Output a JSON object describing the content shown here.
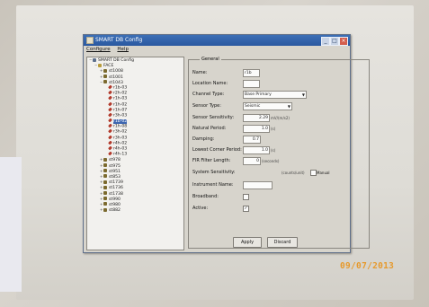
{
  "window": {
    "title": "SMART DB Config",
    "menu": [
      "Configure",
      "Help"
    ],
    "min_icon": "minimize-icon",
    "max_icon": "maximize-icon",
    "close_icon": "close-icon"
  },
  "tree": {
    "items": [
      {
        "label": "SMART DB Config",
        "depth": 0,
        "toggle": "−",
        "icon": "root-icon",
        "kind": "root"
      },
      {
        "label": "FACE",
        "depth": 1,
        "toggle": "−",
        "icon": "folder-icon",
        "kind": "folder"
      },
      {
        "label": "st1008",
        "depth": 2,
        "toggle": "+",
        "icon": "station-icon",
        "kind": "station"
      },
      {
        "label": "st1001",
        "depth": 2,
        "toggle": "+",
        "icon": "station-icon",
        "kind": "station"
      },
      {
        "label": "st1043",
        "depth": 2,
        "toggle": "−",
        "icon": "station-icon",
        "kind": "station"
      },
      {
        "label": "r1b-03",
        "depth": 3,
        "toggle": "",
        "icon": "sensor-icon",
        "kind": "sensor"
      },
      {
        "label": "r2h-02",
        "depth": 3,
        "toggle": "",
        "icon": "sensor-icon",
        "kind": "sensor"
      },
      {
        "label": "r1h-03",
        "depth": 3,
        "toggle": "",
        "icon": "sensor-icon",
        "kind": "sensor"
      },
      {
        "label": "r1h-02",
        "depth": 3,
        "toggle": "",
        "icon": "sensor-icon",
        "kind": "sensor"
      },
      {
        "label": "r1h-07",
        "depth": 3,
        "toggle": "",
        "icon": "sensor-icon",
        "kind": "sensor"
      },
      {
        "label": "r3h-03",
        "depth": 3,
        "toggle": "",
        "icon": "sensor-icon",
        "kind": "sensor"
      },
      {
        "label": "r1b-02",
        "depth": 3,
        "toggle": "",
        "icon": "sensor-icon",
        "kind": "sensor",
        "selected": true
      },
      {
        "label": "r1h-08",
        "depth": 3,
        "toggle": "",
        "icon": "sensor-icon",
        "kind": "sensor"
      },
      {
        "label": "r3h-02",
        "depth": 3,
        "toggle": "",
        "icon": "sensor-icon",
        "kind": "sensor"
      },
      {
        "label": "r3h-03",
        "depth": 3,
        "toggle": "",
        "icon": "sensor-icon",
        "kind": "sensor"
      },
      {
        "label": "r4h-02",
        "depth": 3,
        "toggle": "",
        "icon": "sensor-icon",
        "kind": "sensor"
      },
      {
        "label": "r4h-03",
        "depth": 3,
        "toggle": "",
        "icon": "sensor-icon",
        "kind": "sensor"
      },
      {
        "label": "r4h-13",
        "depth": 3,
        "toggle": "",
        "icon": "sensor-icon",
        "kind": "sensor"
      },
      {
        "label": "st978",
        "depth": 2,
        "toggle": "+",
        "icon": "station-icon",
        "kind": "station"
      },
      {
        "label": "st975",
        "depth": 2,
        "toggle": "+",
        "icon": "station-icon",
        "kind": "station"
      },
      {
        "label": "st951",
        "depth": 2,
        "toggle": "+",
        "icon": "station-icon",
        "kind": "station"
      },
      {
        "label": "st853",
        "depth": 2,
        "toggle": "+",
        "icon": "station-icon",
        "kind": "station"
      },
      {
        "label": "st1739",
        "depth": 2,
        "toggle": "+",
        "icon": "station-icon",
        "kind": "station"
      },
      {
        "label": "st1736",
        "depth": 2,
        "toggle": "+",
        "icon": "station-icon",
        "kind": "station"
      },
      {
        "label": "st1738",
        "depth": 2,
        "toggle": "+",
        "icon": "station-icon",
        "kind": "station"
      },
      {
        "label": "st990",
        "depth": 2,
        "toggle": "+",
        "icon": "station-icon",
        "kind": "station"
      },
      {
        "label": "st980",
        "depth": 2,
        "toggle": "+",
        "icon": "station-icon",
        "kind": "station"
      },
      {
        "label": "st882",
        "depth": 2,
        "toggle": "+",
        "icon": "station-icon",
        "kind": "station"
      }
    ]
  },
  "form": {
    "group_title": "General",
    "name_label": "Name:",
    "name_value": "r1b",
    "location_label": "Location Name:",
    "location_value": "",
    "channel_type_label": "Channel Type:",
    "channel_type_value": "Base Primary",
    "sensor_type_label": "Sensor Type:",
    "sensor_type_value": "Seismic",
    "sensitivity_label": "Sensor Sensitivity:",
    "sensitivity_value": "2.29",
    "sensitivity_unit": "mV/(m/s2)",
    "natural_period_label": "Natural Period:",
    "natural_period_value": "1.0",
    "natural_period_unit": "(s)",
    "damping_label": "Damping:",
    "damping_value": "0.7",
    "corner_period_label": "Lowest Corner Period:",
    "corner_period_value": "1.0",
    "corner_period_unit": "(s)",
    "fir_length_label": "FIR Filter Length:",
    "fir_length_value": "0",
    "fir_length_unit": "(seconds)",
    "system_sens_label": "System Sensitivity:",
    "system_sens_value": "(counts/unit)",
    "manual_label": "Manual",
    "instrument_label": "Instrument Name:",
    "instrument_value": "",
    "broadband_label": "Broadband:",
    "broadband_checked": "",
    "active_label": "Active:",
    "active_checked": "✓"
  },
  "buttons": {
    "apply_label": "Apply",
    "discard_label": "Discard"
  },
  "photo": {
    "date_stamp": "09/07/2013"
  },
  "colors": {
    "titlebar": "#2a58a0",
    "selection": "#3d66b0",
    "station_icon": "#7b6a2e",
    "sensor_icon": "#b23a2c",
    "date_stamp": "#e69a2d"
  }
}
